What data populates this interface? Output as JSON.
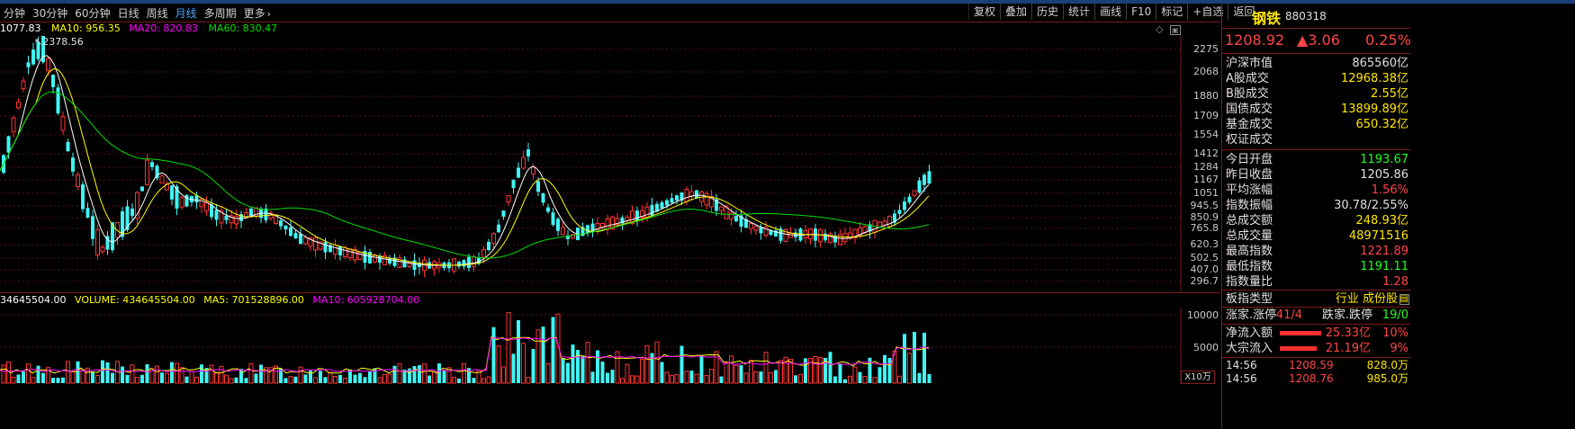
{
  "toolbar": {
    "periods": [
      "分钟",
      "30分钟",
      "60分钟",
      "日线",
      "周线",
      "月线",
      "多周期",
      "更多"
    ],
    "active_period": "月线",
    "functions": [
      "复权",
      "叠加",
      "历史",
      "统计",
      "画线",
      "F10",
      "标记",
      "+自选",
      "返回"
    ]
  },
  "ma_legend": {
    "value_start": "1077.83",
    "ma10": "MA10: 956.35",
    "ma20": "MA20: 820.83",
    "ma60": "MA60: 830.47",
    "peak_label": "2378.56"
  },
  "price_axis": [
    "2275",
    "2068",
    "1880",
    "1709",
    "1554",
    "1412",
    "1284",
    "1167",
    "1051",
    "945.5",
    "850.9",
    "765.8",
    "620.3",
    "502.5",
    "407.0",
    "296.7"
  ],
  "volume_legend": {
    "value_start": "34645504.00",
    "volume": "VOLUME: 434645504.00",
    "ma5": "MA5: 701528896.00",
    "ma10": "MA10: 605928704.00"
  },
  "volume_axis": [
    "10000",
    "5000"
  ],
  "volume_unit": "X10万",
  "colors": {
    "up": "#ff3535",
    "down": "#3ff5f5",
    "ma5": "#ffffff",
    "ma10": "#ffff00",
    "ma20": "#ff00ff",
    "ma60": "#00dd00",
    "accent": "#49a7ff"
  },
  "panel": {
    "name": "钢铁",
    "code": "880318",
    "price": "1208.92",
    "change": "▲3.06",
    "change_pct": "0.25%",
    "market": [
      {
        "label": "沪深市值",
        "value": "865560亿",
        "color": "#e0e0e0"
      },
      {
        "label": "A股成交",
        "value": "12968.38亿",
        "color": "#ffe700"
      },
      {
        "label": "B股成交",
        "value": "2.55亿",
        "color": "#ffe700"
      },
      {
        "label": "国债成交",
        "value": "13899.89亿",
        "color": "#ffe700"
      },
      {
        "label": "基金成交",
        "value": "650.32亿",
        "color": "#ffe700"
      },
      {
        "label": "权证成交",
        "value": "",
        "color": "#ffe700"
      }
    ],
    "stats": [
      {
        "label": "今日开盘",
        "value": "1193.67",
        "color": "#1fff1f"
      },
      {
        "label": "昨日收盘",
        "value": "1205.86",
        "color": "#e0e0e0"
      },
      {
        "label": "平均涨幅",
        "value": "1.56%",
        "color": "#ff4545"
      },
      {
        "label": "指数振幅",
        "value": "30.78/2.55%",
        "color": "#e0e0e0"
      },
      {
        "label": "总成交额",
        "value": "248.93亿",
        "color": "#ffe700"
      },
      {
        "label": "总成交量",
        "value": "48971516",
        "color": "#ffe700"
      },
      {
        "label": "最高指数",
        "value": "1221.89",
        "color": "#ff4545"
      },
      {
        "label": "最低指数",
        "value": "1191.11",
        "color": "#1fff1f"
      },
      {
        "label": "指数量比",
        "value": "1.28",
        "color": "#ff4545"
      }
    ],
    "board_type_label": "板指类型",
    "board_type_value": "行业 成份股",
    "updown_label": "涨家.涨停",
    "updown_value": "41/4",
    "down_label": "跌家.跌停",
    "down_value": "19/0",
    "flows": [
      {
        "label": "净流入额",
        "value": "25.33亿",
        "pct": "10%",
        "fill": 0.1
      },
      {
        "label": "大宗流入",
        "value": "21.19亿",
        "pct": "9%",
        "fill": 0.09
      }
    ],
    "ticks": [
      {
        "time": "14:56",
        "price": "1208.59",
        "vol": "828.0万"
      },
      {
        "time": "14:56",
        "price": "1208.76",
        "vol": "985.0万"
      }
    ]
  }
}
